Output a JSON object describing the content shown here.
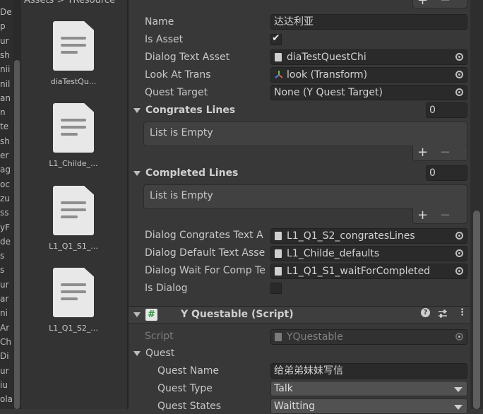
{
  "project": {
    "breadcrumb": "Assets > YResource",
    "assets": [
      {
        "label": "diaTestQu..."
      },
      {
        "label": "L1_Childe_..."
      },
      {
        "label": "L1_Q1_S1_..."
      },
      {
        "label": "L1_Q1_S2_..."
      }
    ],
    "left_strip_fragments": [
      "De",
      "p",
      "ur",
      "sh",
      "nii",
      "nil",
      "an",
      "n",
      "te",
      "sh",
      "er",
      "ag",
      "oc",
      "zu",
      "ss",
      "yF",
      "de",
      "s",
      "s",
      "ur",
      "ar",
      "ni",
      "Ar",
      "Ch",
      "Di",
      "ur",
      "iu",
      "ola"
    ]
  },
  "inspector": {
    "rows": {
      "name": {
        "label": "Name",
        "value": "达达利亚"
      },
      "is_asset": {
        "label": "Is Asset"
      },
      "dialog_text_asset": {
        "label": "Dialog Text Asset",
        "value": "diaTestQuestChi"
      },
      "look_at_trans": {
        "label": "Look At Trans",
        "value": "look (Transform)"
      },
      "quest_target": {
        "label": "Quest Target",
        "value": "None (Y Quest Target)"
      }
    },
    "congrates_lines": {
      "title": "Congrates Lines",
      "count": "0",
      "empty_text": "List is Empty"
    },
    "completed_lines": {
      "title": "Completed Lines",
      "count": "0",
      "empty_text": "List is Empty"
    },
    "dialog_rows": {
      "congrates": {
        "label": "Dialog Congrates Text A",
        "value": "L1_Q1_S2_congratesLines"
      },
      "default": {
        "label": "Dialog Default Text Asse",
        "value": "L1_Childe_defaults"
      },
      "wait": {
        "label": "Dialog Wait For Comp Te",
        "value": "L1_Q1_S1_waitForCompleted"
      },
      "is_dialog": {
        "label": "Is Dialog"
      }
    },
    "component": {
      "title": "Y Questable (Script)",
      "script_label": "Script",
      "script_value": "YQuestable",
      "quest_label": "Quest",
      "quest_name_label": "Quest Name",
      "quest_name_value": "给弟弟妹妹写信",
      "quest_type_label": "Quest Type",
      "quest_type_value": "Talk",
      "quest_states_label": "Quest States",
      "quest_states_value": "Waitting"
    },
    "list_buttons": {
      "plus": "+",
      "minus": "−"
    }
  },
  "colors": {
    "panel_bg": "#383838",
    "field_bg": "#2a2a2a",
    "header_bg": "#3e3e3e",
    "script_icon": "#2b9a3d"
  }
}
